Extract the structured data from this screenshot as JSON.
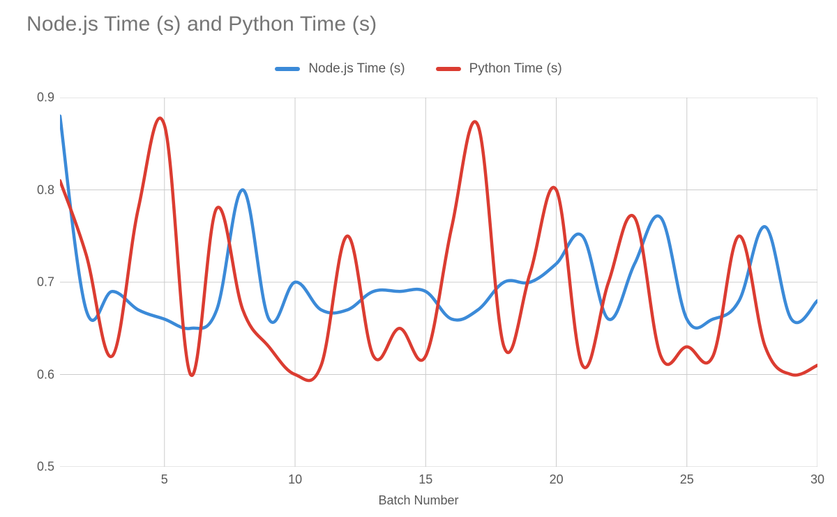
{
  "chart_data": {
    "type": "line",
    "title": "Node.js Time (s) and Python Time (s)",
    "xlabel": "Batch Number",
    "ylabel": "",
    "xlim": [
      1,
      30
    ],
    "ylim": [
      0.5,
      0.9
    ],
    "xticks": [
      5,
      10,
      15,
      20,
      25,
      30
    ],
    "yticks": [
      0.5,
      0.6,
      0.7,
      0.8,
      0.9
    ],
    "x": [
      1,
      2,
      3,
      4,
      5,
      6,
      7,
      8,
      9,
      10,
      11,
      12,
      13,
      14,
      15,
      16,
      17,
      18,
      19,
      20,
      21,
      22,
      23,
      24,
      25,
      26,
      27,
      28,
      29,
      30
    ],
    "series": [
      {
        "name": "Node.js Time (s)",
        "color": "#3b8ad8",
        "values": [
          0.88,
          0.67,
          0.69,
          0.67,
          0.66,
          0.65,
          0.67,
          0.8,
          0.66,
          0.7,
          0.67,
          0.67,
          0.69,
          0.69,
          0.69,
          0.66,
          0.67,
          0.7,
          0.7,
          0.72,
          0.75,
          0.66,
          0.72,
          0.77,
          0.66,
          0.66,
          0.68,
          0.76,
          0.66,
          0.68
        ]
      },
      {
        "name": "Python Time (s)",
        "color": "#db3c31",
        "values": [
          0.81,
          0.73,
          0.62,
          0.78,
          0.87,
          0.6,
          0.78,
          0.67,
          0.63,
          0.6,
          0.61,
          0.75,
          0.62,
          0.65,
          0.62,
          0.76,
          0.87,
          0.63,
          0.71,
          0.8,
          0.61,
          0.7,
          0.77,
          0.62,
          0.63,
          0.62,
          0.75,
          0.63,
          0.6,
          0.61
        ]
      }
    ],
    "legend_position": "top"
  }
}
